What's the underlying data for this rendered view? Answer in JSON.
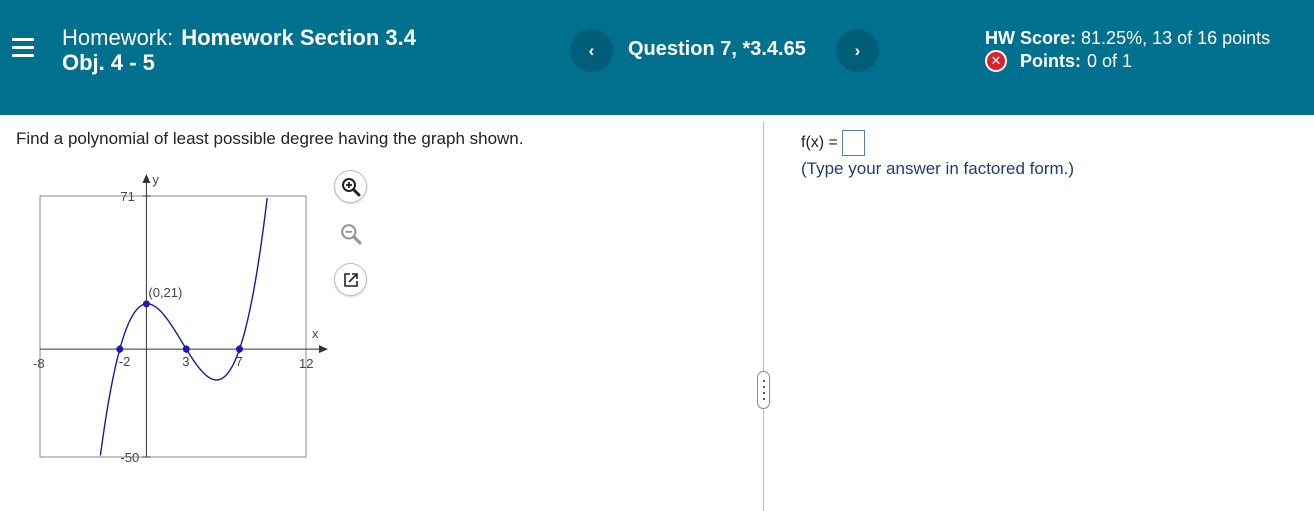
{
  "header": {
    "assignment_label": "Homework:",
    "assignment_name": "Homework Section 3.4",
    "objective": "Obj. 4 - 5",
    "question_label": "Question 7, *3.4.65",
    "prev_symbol": "‹",
    "next_symbol": "›",
    "hw_score_label": "HW Score:",
    "hw_score_value": "81.25%, 13 of 16 points",
    "points_label": "Points:",
    "points_value": "0 of 1",
    "points_status_icon": "x-circle-icon",
    "colors": {
      "bar": "#00708f",
      "nav_button": "#005e78",
      "wrong": "#e0212f"
    }
  },
  "question": {
    "prompt": "Find a polynomial of least possible degree having the graph shown."
  },
  "answer": {
    "fx_label": "f(x) =",
    "value": "",
    "hint": "(Type your answer in factored form.)"
  },
  "tools": {
    "zoom_in_icon": "zoom-in-icon",
    "zoom_out_icon": "zoom-out-icon",
    "popout_icon": "popout-icon"
  },
  "chart_data": {
    "type": "line",
    "xlabel": "x",
    "ylabel": "y",
    "xlim": [
      -8,
      12
    ],
    "ylim": [
      -50,
      71
    ],
    "x_tick_labels": [
      "-8",
      "-2",
      "3",
      "7",
      "12"
    ],
    "y_tick_labels": [
      "71",
      "-50"
    ],
    "grid": false,
    "series": [
      {
        "function": "(x+2)(x-3)(x-7)/2",
        "color": "#1a1aa0"
      }
    ],
    "points": [
      {
        "x": -2,
        "y": 0,
        "label": ""
      },
      {
        "x": 0,
        "y": 21,
        "label": "(0,21)"
      },
      {
        "x": 3,
        "y": 0,
        "label": ""
      },
      {
        "x": 7,
        "y": 0,
        "label": ""
      }
    ]
  }
}
